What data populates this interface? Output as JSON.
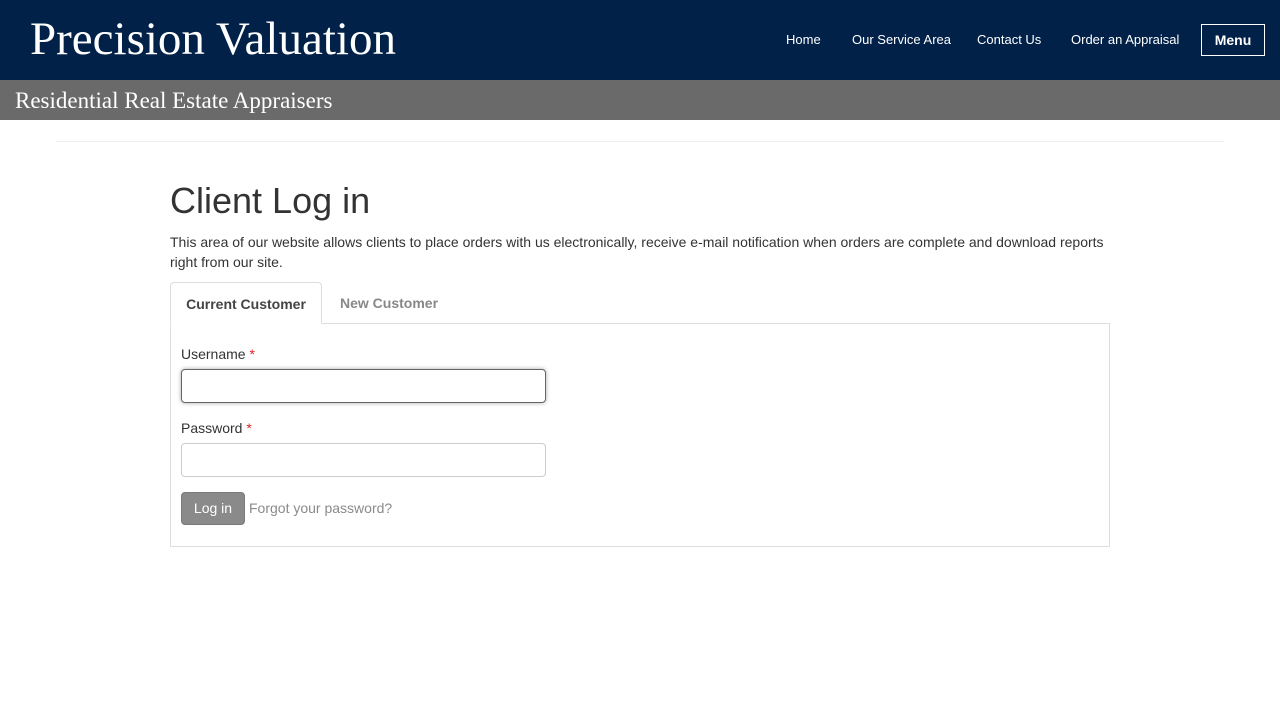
{
  "header": {
    "brand": "Precision Valuation",
    "nav": [
      {
        "label": "Home"
      },
      {
        "label": "Our Service Area"
      },
      {
        "label": "Contact Us"
      },
      {
        "label": "Order an Appraisal"
      }
    ],
    "menu_label": "Menu",
    "tagline": "Residential Real Estate Appraisers"
  },
  "main": {
    "title": "Client Log in",
    "intro": "This area of our website allows clients to place orders with us electronically, receive e-mail notification when orders are complete and download reports right from our site.",
    "tabs": [
      {
        "label": "Current Customer",
        "active": true
      },
      {
        "label": "New Customer",
        "active": false
      }
    ],
    "form": {
      "username_label": "Username",
      "username_value": "",
      "password_label": "Password",
      "password_value": "",
      "required_marker": "*",
      "login_label": "Log in",
      "forgot_label": "Forgot your password?"
    }
  },
  "colors": {
    "header_bg": "#012149",
    "tagline_bg": "#6b6a6a",
    "required": "#e0201c",
    "button_bg": "#8a8a8a"
  }
}
